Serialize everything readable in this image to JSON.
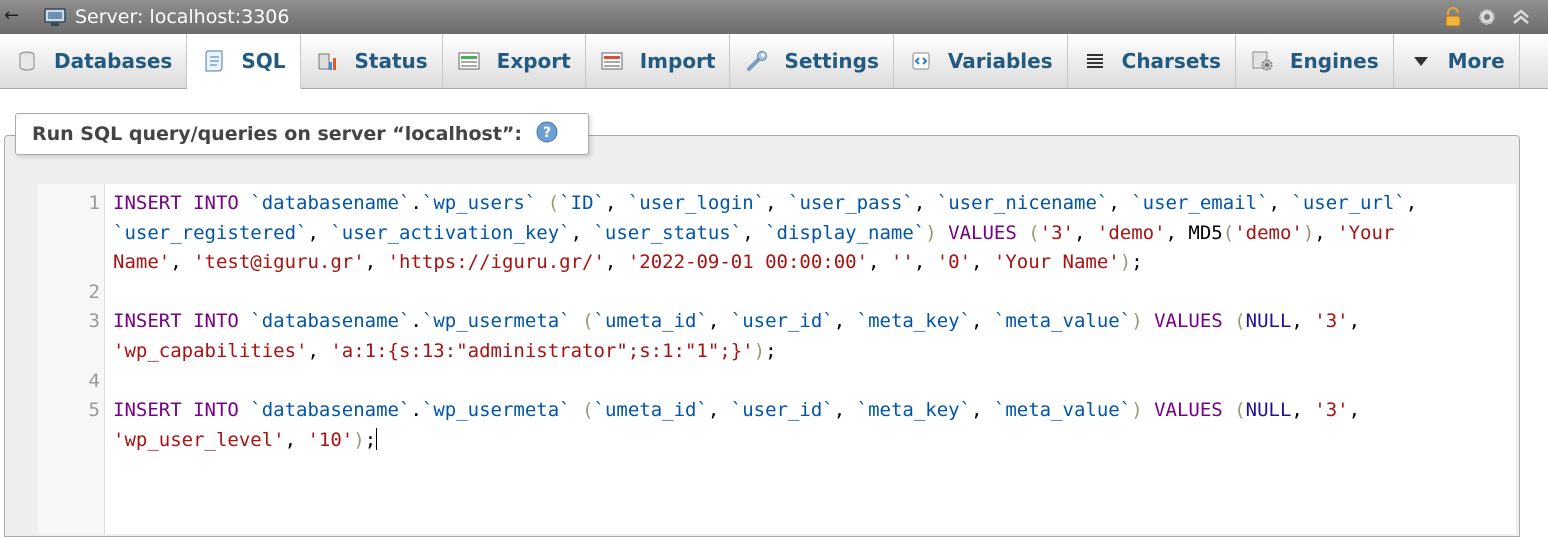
{
  "titlebar": {
    "title": "Server: localhost:3306",
    "icons": [
      "back-arrow-icon",
      "server-icon",
      "lock-icon",
      "gear-icon",
      "collapse-icon"
    ]
  },
  "tabs": [
    {
      "label": "Databases",
      "icon": "database-icon",
      "active": false
    },
    {
      "label": "SQL",
      "icon": "sql-icon",
      "active": true
    },
    {
      "label": "Status",
      "icon": "status-icon",
      "active": false
    },
    {
      "label": "Export",
      "icon": "export-icon",
      "active": false
    },
    {
      "label": "Import",
      "icon": "import-icon",
      "active": false
    },
    {
      "label": "Settings",
      "icon": "wrench-icon",
      "active": false
    },
    {
      "label": "Variables",
      "icon": "variables-icon",
      "active": false
    },
    {
      "label": "Charsets",
      "icon": "charsets-icon",
      "active": false
    },
    {
      "label": "Engines",
      "icon": "engines-icon",
      "active": false
    },
    {
      "label": "More",
      "icon": "caret-down-icon",
      "active": false
    }
  ],
  "panel": {
    "legend": "Run SQL query/queries on server “localhost”:"
  },
  "editor": {
    "line_numbers": [
      "1",
      "2",
      "3",
      "4",
      "5"
    ],
    "lines": [
      [
        [
          "kw",
          "INSERT INTO "
        ],
        [
          "id",
          "`databasename`"
        ],
        [
          "n",
          "."
        ],
        [
          "id",
          "`wp_users`"
        ],
        [
          "n",
          " "
        ],
        [
          "br",
          "("
        ],
        [
          "id",
          "`ID`"
        ],
        [
          "n",
          ", "
        ],
        [
          "id",
          "`user_login`"
        ],
        [
          "n",
          ", "
        ],
        [
          "id",
          "`user_pass`"
        ],
        [
          "n",
          ", "
        ],
        [
          "id",
          "`user_nicename`"
        ],
        [
          "n",
          ", "
        ],
        [
          "id",
          "`user_email`"
        ],
        [
          "n",
          ", "
        ],
        [
          "id",
          "`user_url`"
        ],
        [
          "n",
          ","
        ]
      ],
      [
        [
          "id",
          "`user_registered`"
        ],
        [
          "n",
          ", "
        ],
        [
          "id",
          "`user_activation_key`"
        ],
        [
          "n",
          ", "
        ],
        [
          "id",
          "`user_status`"
        ],
        [
          "n",
          ", "
        ],
        [
          "id",
          "`display_name`"
        ],
        [
          "br",
          ")"
        ],
        [
          "n",
          " "
        ],
        [
          "kw",
          "VALUES "
        ],
        [
          "br",
          "("
        ],
        [
          "st",
          "'3'"
        ],
        [
          "n",
          ", "
        ],
        [
          "st",
          "'demo'"
        ],
        [
          "n",
          ", MD5"
        ],
        [
          "br",
          "("
        ],
        [
          "st",
          "'demo'"
        ],
        [
          "br",
          ")"
        ],
        [
          "n",
          ", "
        ],
        [
          "st",
          "'Your"
        ]
      ],
      [
        [
          "st",
          "Name'"
        ],
        [
          "n",
          ", "
        ],
        [
          "st",
          "'test@iguru.gr'"
        ],
        [
          "n",
          ", "
        ],
        [
          "st",
          "'https://iguru.gr/'"
        ],
        [
          "n",
          ", "
        ],
        [
          "st",
          "'2022-09-01 00:00:00'"
        ],
        [
          "n",
          ", "
        ],
        [
          "st",
          "''"
        ],
        [
          "n",
          ", "
        ],
        [
          "st",
          "'0'"
        ],
        [
          "n",
          ", "
        ],
        [
          "st",
          "'Your Name'"
        ],
        [
          "br",
          ")"
        ],
        [
          "n",
          ";"
        ]
      ],
      [],
      [
        [
          "kw",
          "INSERT INTO "
        ],
        [
          "id",
          "`databasename`"
        ],
        [
          "n",
          "."
        ],
        [
          "id",
          "`wp_usermeta`"
        ],
        [
          "n",
          " "
        ],
        [
          "br",
          "("
        ],
        [
          "id",
          "`umeta_id`"
        ],
        [
          "n",
          ", "
        ],
        [
          "id",
          "`user_id`"
        ],
        [
          "n",
          ", "
        ],
        [
          "id",
          "`meta_key`"
        ],
        [
          "n",
          ", "
        ],
        [
          "id",
          "`meta_value`"
        ],
        [
          "br",
          ")"
        ],
        [
          "n",
          " "
        ],
        [
          "kw",
          "VALUES "
        ],
        [
          "br",
          "("
        ],
        [
          "nl",
          "NULL"
        ],
        [
          "n",
          ", "
        ],
        [
          "st",
          "'3'"
        ],
        [
          "n",
          ","
        ]
      ],
      [
        [
          "st",
          "'wp_capabilities'"
        ],
        [
          "n",
          ", "
        ],
        [
          "st",
          "'a:1:{s:13:\"administrator\";s:1:\"1\";}'"
        ],
        [
          "br",
          ")"
        ],
        [
          "n",
          ";"
        ]
      ],
      [],
      [
        [
          "kw",
          "INSERT INTO "
        ],
        [
          "id",
          "`databasename`"
        ],
        [
          "n",
          "."
        ],
        [
          "id",
          "`wp_usermeta`"
        ],
        [
          "n",
          " "
        ],
        [
          "br",
          "("
        ],
        [
          "id",
          "`umeta_id`"
        ],
        [
          "n",
          ", "
        ],
        [
          "id",
          "`user_id`"
        ],
        [
          "n",
          ", "
        ],
        [
          "id",
          "`meta_key`"
        ],
        [
          "n",
          ", "
        ],
        [
          "id",
          "`meta_value`"
        ],
        [
          "br",
          ")"
        ],
        [
          "n",
          " "
        ],
        [
          "kw",
          "VALUES "
        ],
        [
          "br",
          "("
        ],
        [
          "nl",
          "NULL"
        ],
        [
          "n",
          ", "
        ],
        [
          "st",
          "'3'"
        ],
        [
          "n",
          ","
        ]
      ],
      [
        [
          "st",
          "'wp_user_level'"
        ],
        [
          "n",
          ", "
        ],
        [
          "st",
          "'10'"
        ],
        [
          "br",
          ")"
        ],
        [
          "n",
          ";"
        ],
        [
          "cursor",
          ""
        ]
      ]
    ]
  }
}
